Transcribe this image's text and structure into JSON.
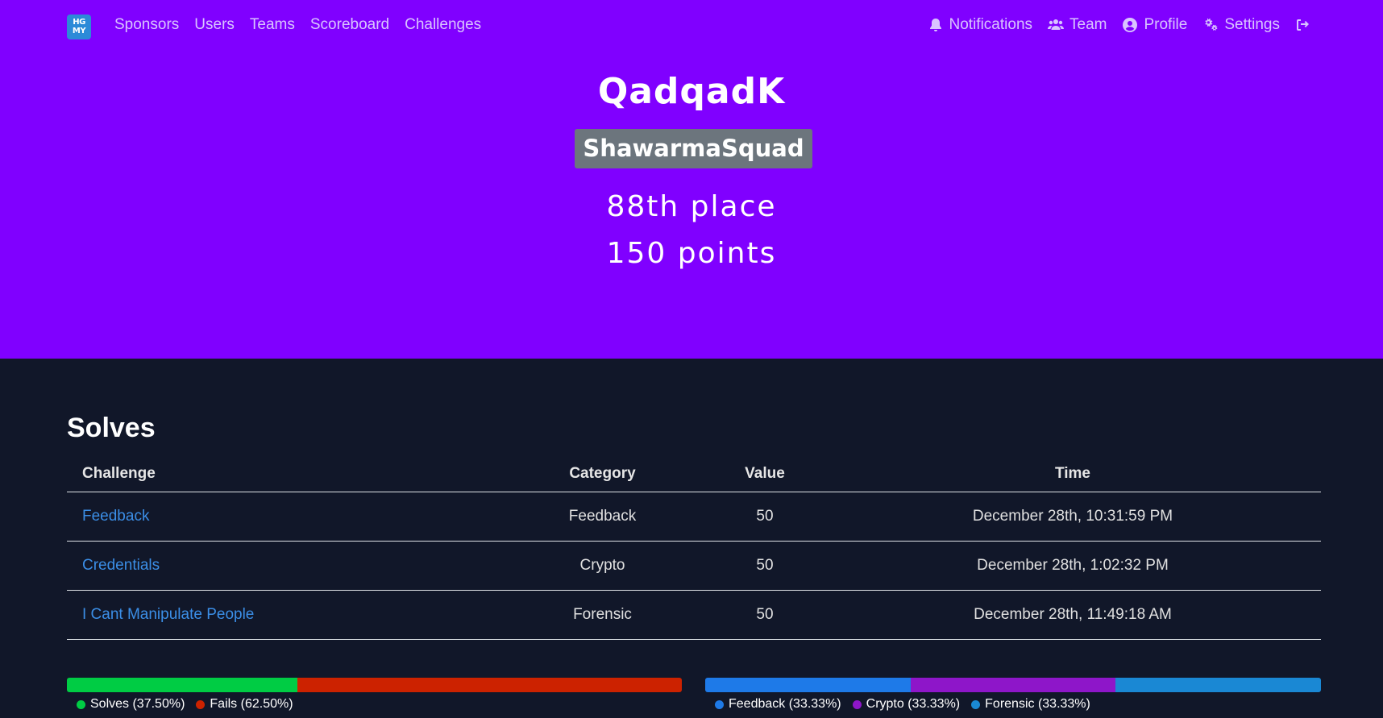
{
  "nav": {
    "logo_text": "HG MY",
    "left_links": [
      "Sponsors",
      "Users",
      "Teams",
      "Scoreboard",
      "Challenges"
    ],
    "right_items": [
      {
        "label": "Notifications",
        "icon": "bell-icon"
      },
      {
        "label": "Team",
        "icon": "users-icon"
      },
      {
        "label": "Profile",
        "icon": "user-circle-icon"
      },
      {
        "label": "Settings",
        "icon": "cogs-icon"
      },
      {
        "label": "",
        "icon": "logout-icon"
      }
    ]
  },
  "user": {
    "name": "QadqadK",
    "team": "ShawarmaSquad",
    "place": "88th place",
    "points": "150 points"
  },
  "solves": {
    "title": "Solves",
    "columns": [
      "Challenge",
      "Category",
      "Value",
      "Time"
    ],
    "rows": [
      {
        "challenge": "Feedback",
        "category": "Feedback",
        "value": "50",
        "time": "December 28th, 10:31:59 PM"
      },
      {
        "challenge": "Credentials",
        "category": "Crypto",
        "value": "50",
        "time": "December 28th, 1:02:32 PM"
      },
      {
        "challenge": "I Cant Manipulate People",
        "category": "Forensic",
        "value": "50",
        "time": "December 28th, 11:49:18 AM"
      }
    ]
  },
  "chart_data": [
    {
      "type": "bar",
      "stacked": "horizontal-percent",
      "categories": [
        "Solves",
        "Fails"
      ],
      "values": [
        37.5,
        62.5
      ],
      "legend": [
        "Solves (37.50%)",
        "Fails (62.50%)"
      ],
      "colors": [
        "#00cc44",
        "#cc2200"
      ]
    },
    {
      "type": "bar",
      "stacked": "horizontal-percent",
      "categories": [
        "Feedback",
        "Crypto",
        "Forensic"
      ],
      "values": [
        33.33,
        33.33,
        33.33
      ],
      "legend": [
        "Feedback (33.33%)",
        "Crypto (33.33%)",
        "Forensic (33.33%)"
      ],
      "colors": [
        "#1e7ae8",
        "#8e16c9",
        "#1a88d4"
      ]
    }
  ],
  "colors": {
    "hero_bg": "#8000ff",
    "page_bg": "#111729",
    "link": "#3b8ee6",
    "badge": "#6c757d"
  }
}
